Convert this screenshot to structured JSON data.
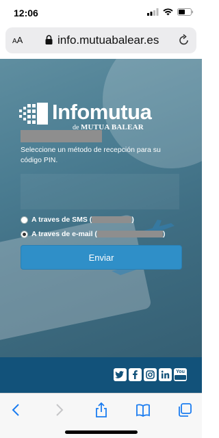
{
  "status": {
    "time": "12:06"
  },
  "browser": {
    "text_size_label_small": "A",
    "text_size_label_large": "A",
    "url": "info.mutuabalear.es"
  },
  "logo": {
    "title": "Infomutua",
    "subtitle_prefix": "de",
    "subtitle_brand": "MUTUA BALEAR"
  },
  "form": {
    "instructions": "Seleccione un método de recepción para su código PIN.",
    "option_sms_label": "A traves de SMS (",
    "option_sms_close": ")",
    "option_email_label": "A traves de e-mail (",
    "option_email_close": ")",
    "selected_option": "email",
    "submit_label": "Enviar"
  },
  "footer": {
    "social": [
      "twitter-icon",
      "facebook-icon",
      "instagram-icon",
      "linkedin-icon",
      "youtube-icon"
    ],
    "youtube_label": "You"
  },
  "colors": {
    "accent": "#2f8fc8",
    "footer": "#12527a",
    "background": "#4a7c91"
  }
}
